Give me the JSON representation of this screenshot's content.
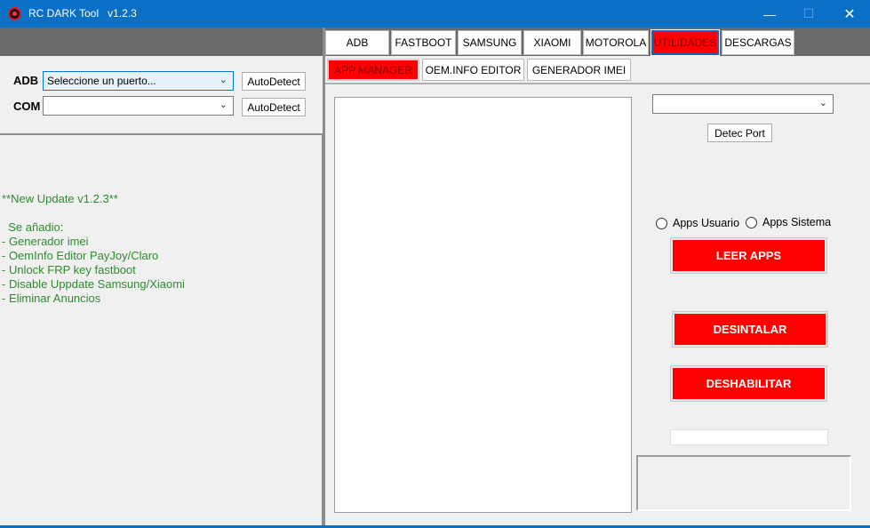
{
  "window": {
    "title": "RC DARK Tool   v1.2.3",
    "controls": {
      "minimize": "—",
      "maximize": "☐",
      "close": "✕"
    }
  },
  "connection": {
    "adb_label": "ADB",
    "adb_value": "Seleccione un puerto...",
    "com_label": "COM",
    "com_value": "",
    "autodetect_label": "AutoDetect"
  },
  "update_notes": "**New Update v1.2.3**\n\n  Se añadio:\n- Generador imei\n- OemInfo Editor PayJoy/Claro\n- Unlock FRP key fastboot\n- Disable Uppdate Samsung/Xiaomi\n- Eliminar Anuncios",
  "tabs": [
    "ADB",
    "FASTBOOT",
    "SAMSUNG",
    "XIAOMI",
    "MOTOROLA",
    "UTILIDADES",
    "DESCARGAS"
  ],
  "subtabs": [
    "APP MANAGER",
    "OEM.INFO EDITOR",
    "GENERADOR IMEI"
  ],
  "app_manager": {
    "port_select_value": "",
    "detect_port_label": "Detec Port",
    "radio_user": "Apps Usuario",
    "radio_system": "Apps Sistema",
    "read_apps": "LEER APPS",
    "uninstall": "DESINTALAR",
    "disable": "DESHABILITAR",
    "progress": 0
  },
  "colors": {
    "titlebar": "#0a6fc7",
    "accent_red": "#ff0000",
    "notes_green": "#2e8b2e"
  }
}
